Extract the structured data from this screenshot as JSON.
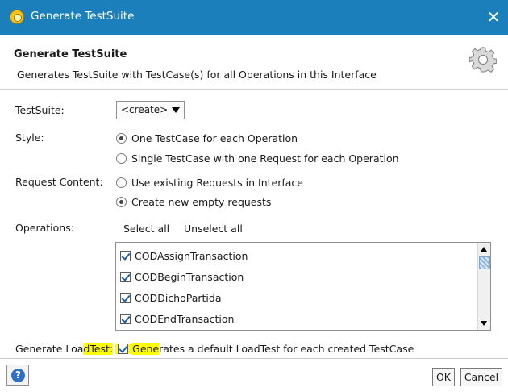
{
  "window": {
    "title": "Generate TestSuite",
    "close_label": "✕"
  },
  "header": {
    "title": "Generate TestSuite",
    "description": "Generates TestSuite with TestCase(s) for all Operations in this Interface"
  },
  "form": {
    "testsuite_label": "TestSuite:",
    "testsuite_value": "<create>",
    "style_label": "Style:",
    "style_options": [
      "One TestCase for each Operation",
      "Single TestCase with one Request for each Operation"
    ],
    "style_selected": "One TestCase for each Operation",
    "request_label": "Request Content:",
    "request_options": [
      "Use existing Requests in Interface",
      "Create new empty requests"
    ],
    "request_selected": "Create new empty requests",
    "operations_label": "Operations:",
    "select_all": "Select all",
    "unselect_all": "Unselect all",
    "operations": [
      {
        "name": "CODAssignTransaction",
        "checked": true
      },
      {
        "name": "CODBeginTransaction",
        "checked": true
      },
      {
        "name": "CODDichoPartida",
        "checked": true
      },
      {
        "name": "CODEndTransaction",
        "checked": true
      }
    ],
    "loadtest_label_a": "Generate Loa",
    "loadtest_label_b": "dTest:",
    "loadtest_checked": true,
    "loadtest_text_a": "Gene",
    "loadtest_text_b": "rates a default LoadTest for each created TestCase"
  },
  "footer": {
    "help_label": "?",
    "ok_label": "OK",
    "cancel_label": "Cancel"
  },
  "colors": {
    "titlebar": "#1a7fba",
    "highlight": "#ffff00",
    "check": "#1d5fa8"
  }
}
